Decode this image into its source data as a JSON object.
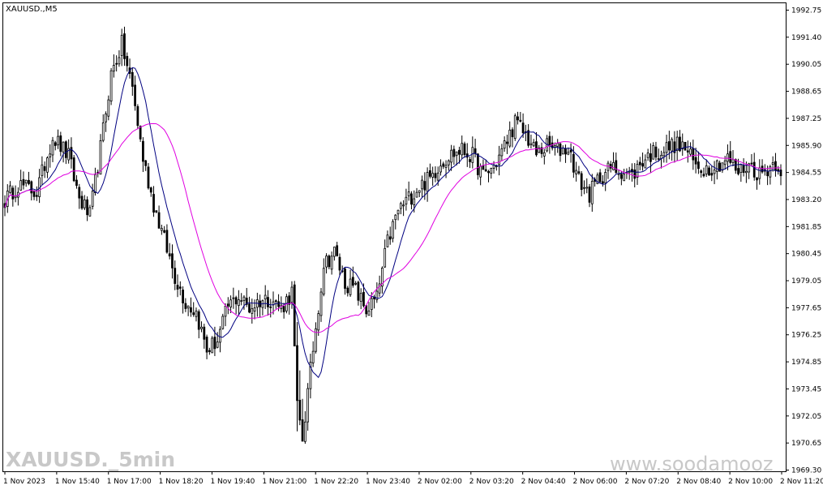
{
  "window": {
    "symbol_label": "XAUUSD.,M5"
  },
  "watermarks": {
    "left": "XAUUSD._5min",
    "right": "www.soodamooz"
  },
  "colors": {
    "background": "#ffffff",
    "candle": "#000000",
    "ma_fast": "#000080",
    "ma_slow": "#e000e0",
    "grid": "#000000"
  },
  "chart_data": {
    "type": "candlestick",
    "ylim": [
      1969.85,
      1993.25
    ],
    "y_ticks": [
      "1992.75",
      "1991.40",
      "1990.05",
      "1988.65",
      "1987.25",
      "1985.90",
      "1984.55",
      "1983.20",
      "1981.85",
      "1980.45",
      "1979.05",
      "1977.65",
      "1976.25",
      "1974.85",
      "1973.45",
      "1972.05",
      "1970.65",
      "1969.30"
    ],
    "x_ticks": [
      "1 Nov 2023",
      "1 Nov 15:40",
      "1 Nov 17:00",
      "1 Nov 18:20",
      "1 Nov 19:40",
      "1 Nov 21:00",
      "1 Nov 22:20",
      "1 Nov 23:40",
      "2 Nov 02:00",
      "2 Nov 03:20",
      "2 Nov 04:40",
      "2 Nov 06:00",
      "2 Nov 07:20",
      "2 Nov 08:40",
      "2 Nov 10:00",
      "2 Nov 11:20"
    ],
    "anchors": [
      [
        0,
        1983.4
      ],
      [
        5,
        1984.2
      ],
      [
        12,
        1983.8
      ],
      [
        18,
        1986.6
      ],
      [
        24,
        1985.6
      ],
      [
        28,
        1983.5
      ],
      [
        32,
        1982.6
      ],
      [
        36,
        1986.0
      ],
      [
        40,
        1989.7
      ],
      [
        44,
        1991.2
      ],
      [
        48,
        1989.0
      ],
      [
        52,
        1985.5
      ],
      [
        56,
        1983.2
      ],
      [
        60,
        1981.4
      ],
      [
        64,
        1979.6
      ],
      [
        68,
        1978.3
      ],
      [
        72,
        1977.8
      ],
      [
        76,
        1975.9
      ],
      [
        80,
        1976.4
      ],
      [
        84,
        1978.1
      ],
      [
        88,
        1978.6
      ],
      [
        92,
        1978.0
      ],
      [
        96,
        1978.4
      ],
      [
        100,
        1978.5
      ],
      [
        104,
        1978.0
      ],
      [
        108,
        1978.8
      ],
      [
        110,
        1973.0
      ],
      [
        112,
        1971.5
      ],
      [
        116,
        1976.0
      ],
      [
        120,
        1980.2
      ],
      [
        124,
        1980.8
      ],
      [
        128,
        1979.3
      ],
      [
        132,
        1978.9
      ],
      [
        136,
        1977.9
      ],
      [
        140,
        1978.5
      ],
      [
        144,
        1981.3
      ],
      [
        148,
        1982.9
      ],
      [
        152,
        1983.5
      ],
      [
        156,
        1984.1
      ],
      [
        160,
        1984.5
      ],
      [
        164,
        1985.3
      ],
      [
        168,
        1985.7
      ],
      [
        172,
        1985.9
      ],
      [
        176,
        1985.6
      ],
      [
        180,
        1984.6
      ],
      [
        184,
        1985.1
      ],
      [
        188,
        1986.1
      ],
      [
        192,
        1987.3
      ],
      [
        196,
        1986.7
      ],
      [
        200,
        1985.7
      ],
      [
        204,
        1986.1
      ],
      [
        208,
        1985.9
      ],
      [
        212,
        1986.0
      ],
      [
        216,
        1984.4
      ],
      [
        220,
        1983.7
      ],
      [
        224,
        1984.6
      ],
      [
        228,
        1985.0
      ],
      [
        232,
        1984.9
      ],
      [
        236,
        1984.6
      ],
      [
        240,
        1985.4
      ],
      [
        244,
        1985.8
      ],
      [
        248,
        1985.9
      ],
      [
        252,
        1986.2
      ],
      [
        256,
        1986.0
      ],
      [
        260,
        1985.1
      ],
      [
        264,
        1985.0
      ],
      [
        268,
        1985.2
      ],
      [
        272,
        1985.5
      ],
      [
        276,
        1984.8
      ],
      [
        280,
        1985.2
      ],
      [
        284,
        1984.7
      ],
      [
        288,
        1985.1
      ],
      [
        290,
        1985.3
      ],
      [
        292,
        1985.0
      ]
    ],
    "jump_points": [
      110,
      111,
      112
    ],
    "series": [
      {
        "type": "moving-average",
        "period": 10,
        "color": "#000080"
      },
      {
        "type": "moving-average",
        "period": 25,
        "color": "#e000e0"
      }
    ]
  }
}
